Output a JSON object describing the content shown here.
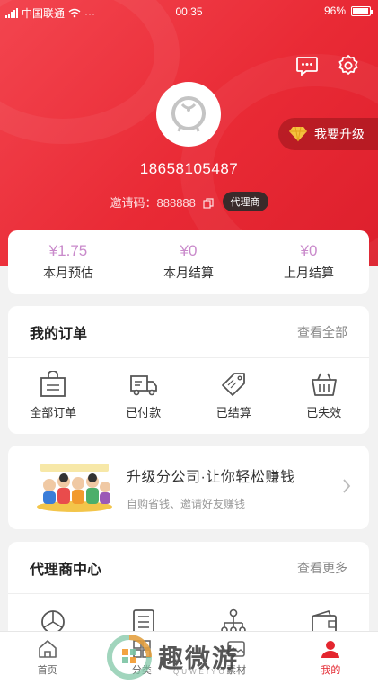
{
  "status_bar": {
    "carrier": "中国联通",
    "time": "00:35",
    "battery": "96%",
    "battery_level": 0.96
  },
  "profile": {
    "phone": "18658105487",
    "invite_label": "邀请码：",
    "invite_code": "888888",
    "role_badge": "代理商",
    "upgrade_label": "我要升级"
  },
  "header_icons": [
    "message-icon",
    "settings-icon"
  ],
  "earnings": [
    {
      "value": "¥1.75",
      "label": "本月预估"
    },
    {
      "value": "¥0",
      "label": "本月结算"
    },
    {
      "value": "¥0",
      "label": "上月结算"
    }
  ],
  "orders": {
    "title": "我的订单",
    "more": "查看全部",
    "items": [
      {
        "label": "全部订单",
        "icon": "bag-icon"
      },
      {
        "label": "已付款",
        "icon": "truck-icon"
      },
      {
        "label": "已结算",
        "icon": "tag-icon"
      },
      {
        "label": "已失效",
        "icon": "basket-icon"
      }
    ]
  },
  "promo": {
    "title": "升级分公司·让你轻松赚钱",
    "subtitle": "自购省钱、邀请好友赚钱"
  },
  "agent_center": {
    "title": "代理商中心",
    "more": "查看更多",
    "icons": [
      "chart-icon",
      "list-icon",
      "team-icon",
      "wallet-icon"
    ]
  },
  "tabs": [
    {
      "label": "首页",
      "icon": "home-icon"
    },
    {
      "label": "分类",
      "icon": "category-icon"
    },
    {
      "label": "素材",
      "icon": "material-icon"
    },
    {
      "label": "我的",
      "icon": "user-icon"
    }
  ],
  "watermark": {
    "text": "趣微游",
    "sub": "QUWEIYOU"
  },
  "colors": {
    "brand_red": "#e92a35",
    "earn_value": "#c98acb",
    "active_tab": "#e4262f"
  }
}
